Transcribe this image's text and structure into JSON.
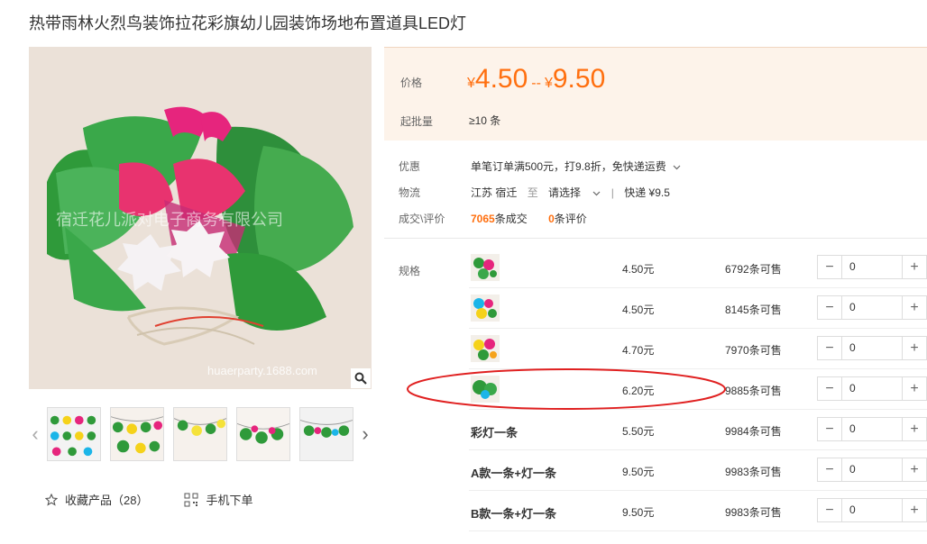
{
  "product": {
    "title": "热带雨林火烈鸟装饰拉花彩旗幼儿园装饰场地布置道具LED灯",
    "watermark_text": "宿迁花儿派对电子商务有限公司",
    "watermark_url": "huaerparty.1688.com"
  },
  "price": {
    "label": "价格",
    "currency": "¥",
    "min": "4.50",
    "separator": "--",
    "max": "9.50",
    "moq_label": "起批量",
    "moq_value": "≥10 条"
  },
  "promo": {
    "label": "优惠",
    "text": "单笔订单满500元，打9.8折，免快递运费"
  },
  "logistics": {
    "label": "物流",
    "from": "江苏 宿迁",
    "to_word": "至",
    "to_select": "请选择",
    "shipping": "快递 ¥9.5"
  },
  "sales": {
    "label": "成交\\评价",
    "deals_count": "7065",
    "deals_unit": "条成交",
    "reviews_count": "0",
    "reviews_unit": "条评价"
  },
  "spec": {
    "label": "规格",
    "rows": [
      {
        "name": "",
        "price": "4.50元",
        "stock": "6792条可售",
        "qty": "0"
      },
      {
        "name": "",
        "price": "4.50元",
        "stock": "8145条可售",
        "qty": "0"
      },
      {
        "name": "",
        "price": "4.70元",
        "stock": "7970条可售",
        "qty": "0"
      },
      {
        "name": "",
        "price": "6.20元",
        "stock": "9885条可售",
        "qty": "0"
      },
      {
        "name": "彩灯一条",
        "price": "5.50元",
        "stock": "9984条可售",
        "qty": "0"
      },
      {
        "name": "A款一条+灯一条",
        "price": "9.50元",
        "stock": "9983条可售",
        "qty": "0"
      },
      {
        "name": "B款一条+灯一条",
        "price": "9.50元",
        "stock": "9983条可售",
        "qty": "0"
      }
    ]
  },
  "actions": {
    "favorite": "收藏产品（28）",
    "mobile_order": "手机下单"
  },
  "colors": {
    "accent": "#ff6f0f",
    "price_bg": "#fdf3ea",
    "annotation": "#e02020"
  }
}
